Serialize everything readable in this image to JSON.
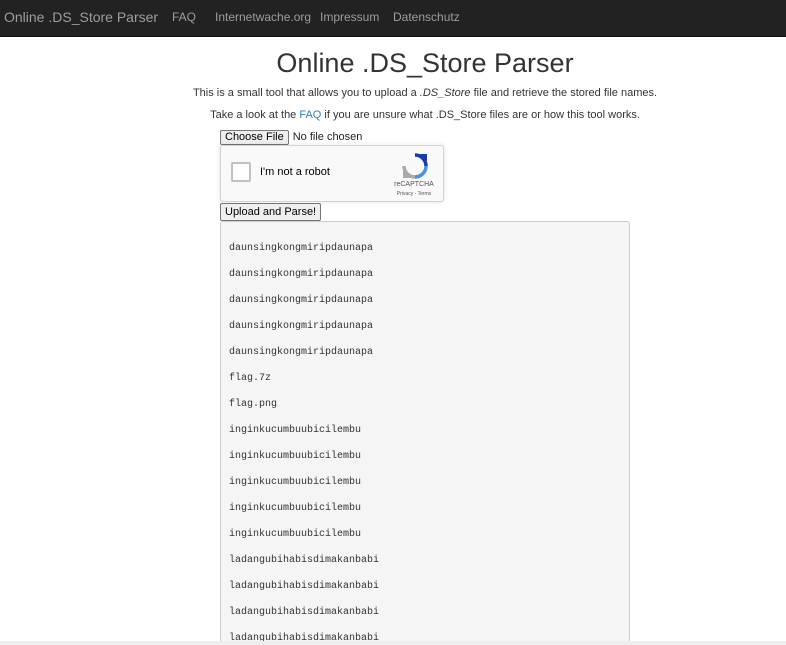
{
  "navbar": {
    "brand": "Online .DS_Store Parser",
    "links": [
      "FAQ",
      "Internetwache.org",
      "Impressum",
      "Datenschutz"
    ]
  },
  "page": {
    "title": "Online .DS_Store Parser",
    "intro1_before": "This is a small tool that allows you to upload a ",
    "intro1_em": ".DS_Store",
    "intro1_after": " file and retrieve the stored file names.",
    "intro2_before": "Take a look at the ",
    "intro2_link": "FAQ",
    "intro2_after": " if you are unsure what .DS_Store files are or how this tool works."
  },
  "file_input": {
    "button_label": "Choose File",
    "status": "No file chosen"
  },
  "recaptcha": {
    "label": "I'm not a robot",
    "brand": "reCAPTCHA",
    "privacy": "Privacy",
    "separator": " - ",
    "terms": "Terms"
  },
  "upload_button": "Upload and Parse!",
  "results": [
    "daunsingkongmiripdaunapa",
    "daunsingkongmiripdaunapa",
    "daunsingkongmiripdaunapa",
    "daunsingkongmiripdaunapa",
    "daunsingkongmiripdaunapa",
    "flag.7z",
    "flag.png",
    "inginkucumbuubicilembu",
    "inginkucumbuubicilembu",
    "inginkucumbuubicilembu",
    "inginkucumbuubicilembu",
    "inginkucumbuubicilembu",
    "ladangubihabisdimakanbabi",
    "ladangubihabisdimakanbabi",
    "ladangubihabisdimakanbabi",
    "ladangubihabisdimakanbabi"
  ],
  "colors": {
    "navbar_bg": "#222222",
    "nav_text": "#9d9d9d",
    "link": "#337ab7",
    "output_bg": "#f5f5f5"
  }
}
